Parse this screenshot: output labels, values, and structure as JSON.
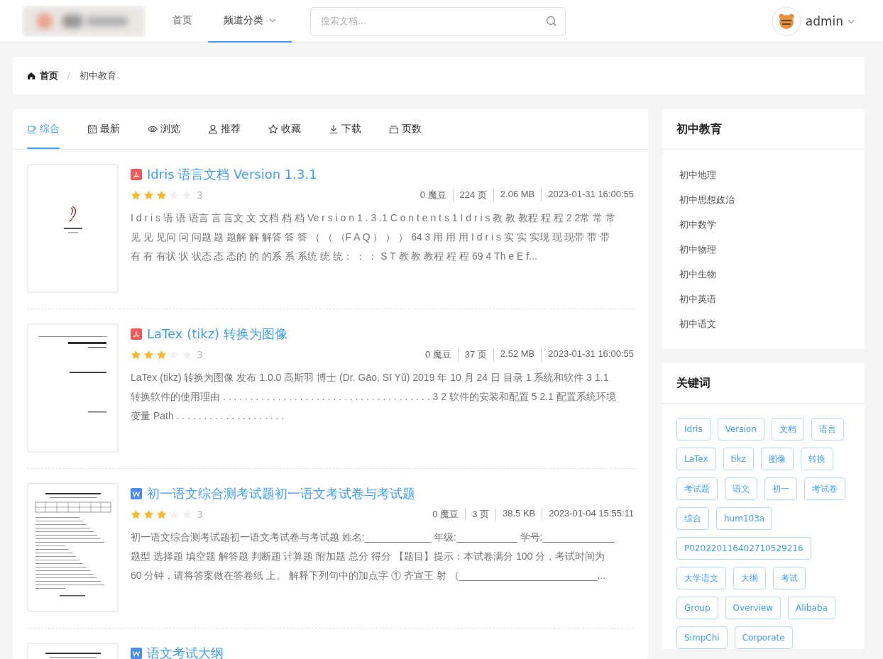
{
  "header": {
    "nav": [
      {
        "label": "首页",
        "selected": false,
        "dropdown": false
      },
      {
        "label": "频道分类",
        "selected": true,
        "dropdown": true
      }
    ],
    "search": {
      "placeholder": "搜索文档..."
    },
    "user": {
      "name": "admin"
    }
  },
  "breadcrumb": [
    "首页",
    "初中教育"
  ],
  "tabs": [
    {
      "label": "综合",
      "selected": true
    },
    {
      "label": "最新",
      "selected": false
    },
    {
      "label": "浏览",
      "selected": false
    },
    {
      "label": "推荐",
      "selected": false
    },
    {
      "label": "收藏",
      "selected": false
    },
    {
      "label": "下载",
      "selected": false
    },
    {
      "label": "页数",
      "selected": false
    }
  ],
  "documents": [
    {
      "kind": "pdf",
      "title": "Idris 语言文档 Version 1.3.1",
      "stars": 3,
      "score": "3",
      "meta": [
        "0 魔豆",
        "224 页",
        "2.06 MB",
        "2023-01-31 16:00:55"
      ],
      "description": "I d r i s 语 语 语言 言 言文 文 文档 档 档 Ve r s i o n 1 . 3 .1 C o n t e n t s 1 I d r i s 教 教 教程 程 程 2 2常 常 常见 见 见问 问 问题 题 题解 解 解答 答 答 （ （ （F A Q ） ） ） 64 3 用 用 用 I d r i s 实 实 实现 现 现带 带 带有 有 有状 状 状态 态 态的 的 的系 系 系统 统 统： ： ： S T 教 教 教程 程 程 69 4 Th e E f..."
    },
    {
      "kind": "pdf",
      "title": "LaTex (tikz) 转换为图像",
      "stars": 3,
      "score": "3",
      "meta": [
        "0 魔豆",
        "37 页",
        "2.52 MB",
        "2023-01-31 16:00:55"
      ],
      "description": "LaTex (tikz) 转换为图像 发布 1.0.0 高斯羽 博士 (Dr. Gāo, Sī Yǔ) 2019 年 10 月 24 日 目录 1 系统和软件 3 1.1 转换软件的使用理由 . . . . . . . . . . . . . . . . . . . . . . . . . . . . . . . . . . . . . . 3 2 软件的安装和配置 5 2.1 配置系统环境变量 Path . . . . . . . . . . . . . . . . . . . ."
    },
    {
      "kind": "word",
      "title": "初一语文综合测考试题初一语文考试卷与考试题",
      "stars": 3,
      "score": "3",
      "meta": [
        "0 魔豆",
        "3 页",
        "38.5 KB",
        "2023-01-04 15:55:11"
      ],
      "description": "初一语文综合测考试题初一语文考试卷与考试题 姓名:____________ 年级:___________ 学号:_____________ 题型 选择题 填空题 解答题 判断题 计算题 附加题 总分 得分 【题目】提示：本试卷满分 100 分，考试时间为 60 分钟，请将答案做在答卷纸 上。 解释下列句中的加点字 ① 齐宣王 射 （_________________________..."
    },
    {
      "kind": "word",
      "title": "语文考试大纲"
    }
  ],
  "category_panel": {
    "title": "初中教育",
    "items": [
      "初中地理",
      "初中思想政治",
      "初中数学",
      "初中物理",
      "初中生物",
      "初中英语",
      "初中语文"
    ]
  },
  "keyword_panel": {
    "title": "关键词",
    "tags": [
      "Idris",
      "Version",
      "文档",
      "语言",
      "LaTex",
      "tikz",
      "图像",
      "转换",
      "考试题",
      "语文",
      "初一",
      "考试卷",
      "综合",
      "hum103a",
      "P020220116402710529216",
      "大学语文",
      "大纲",
      "考试",
      "Group",
      "Overview",
      "Alibaba",
      "SimpChi",
      "Corporate"
    ]
  }
}
